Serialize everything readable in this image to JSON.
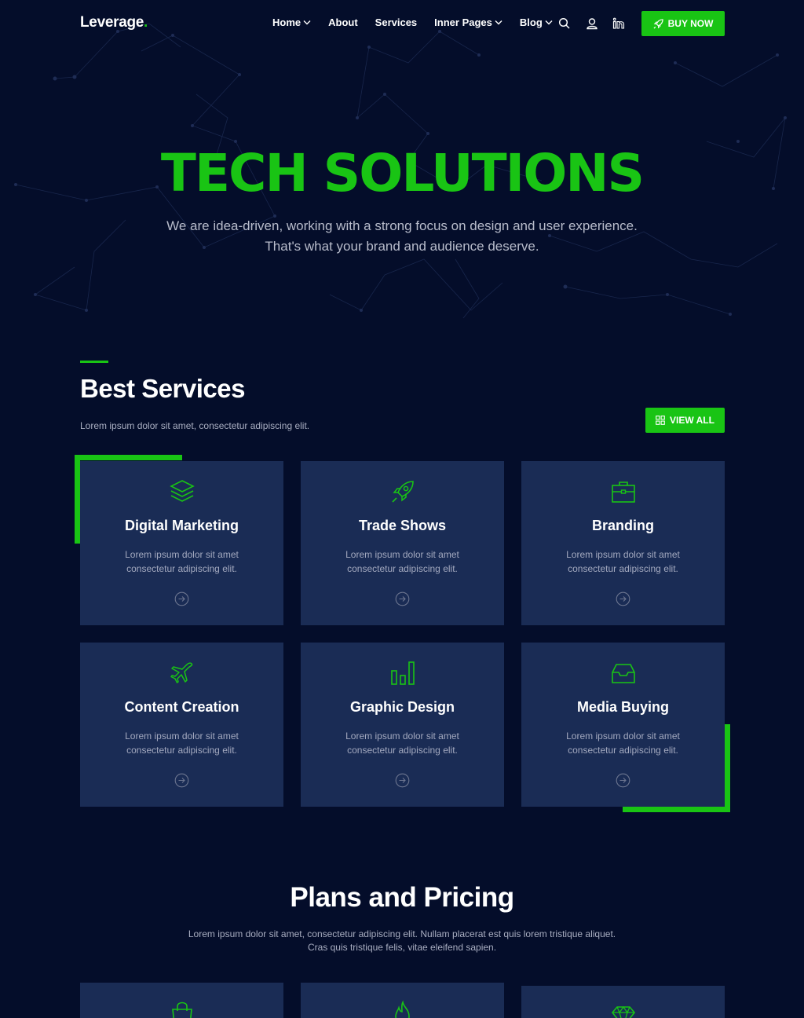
{
  "brand": {
    "name": "Leverage",
    "dot": ".",
    "accent": "#19c414"
  },
  "nav": {
    "items": [
      {
        "label": "Home",
        "has_dropdown": true
      },
      {
        "label": "About",
        "has_dropdown": false
      },
      {
        "label": "Services",
        "has_dropdown": false
      },
      {
        "label": "Inner Pages",
        "has_dropdown": true
      },
      {
        "label": "Blog",
        "has_dropdown": true
      }
    ],
    "icons": [
      "search-icon",
      "user-icon",
      "linkedin-icon"
    ],
    "cta_label": "BUY NOW",
    "cta_icon": "rocket-icon"
  },
  "hero": {
    "title": "TECH SOLUTIONS",
    "subtitle": "We are idea-driven, working with a strong focus on design and user experience. That's what your brand and audience deserve."
  },
  "services": {
    "title": "Best Services",
    "description": "Lorem ipsum dolor sit amet, consectetur adipiscing elit.",
    "view_all_label": "VIEW ALL",
    "view_all_icon": "grid-icon",
    "cards": [
      {
        "icon": "layers-icon",
        "title": "Digital Marketing",
        "desc": "Lorem ipsum dolor sit amet consectetur adipiscing elit."
      },
      {
        "icon": "rocket-icon",
        "title": "Trade Shows",
        "desc": "Lorem ipsum dolor sit amet consectetur adipiscing elit."
      },
      {
        "icon": "briefcase-icon",
        "title": "Branding",
        "desc": "Lorem ipsum dolor sit amet consectetur adipiscing elit."
      },
      {
        "icon": "airplane-icon",
        "title": "Content Creation",
        "desc": "Lorem ipsum dolor sit amet consectetur adipiscing elit."
      },
      {
        "icon": "bar-chart-icon",
        "title": "Graphic Design",
        "desc": "Lorem ipsum dolor sit amet consectetur adipiscing elit."
      },
      {
        "icon": "inbox-icon",
        "title": "Media Buying",
        "desc": "Lorem ipsum dolor sit amet consectetur adipiscing elit."
      }
    ]
  },
  "pricing": {
    "title": "Plans and Pricing",
    "description": "Lorem ipsum dolor sit amet, consectetur adipiscing elit. Nullam placerat est quis lorem tristique aliquet. Cras quis tristique felis, vitae eleifend sapien.",
    "plan_icons": [
      "shopping-bag-icon",
      "fire-icon",
      "diamond-icon"
    ]
  },
  "colors": {
    "background": "#040d2a",
    "card": "#1a2c55",
    "accent": "#19c414",
    "muted_text": "#a3a9bf"
  }
}
